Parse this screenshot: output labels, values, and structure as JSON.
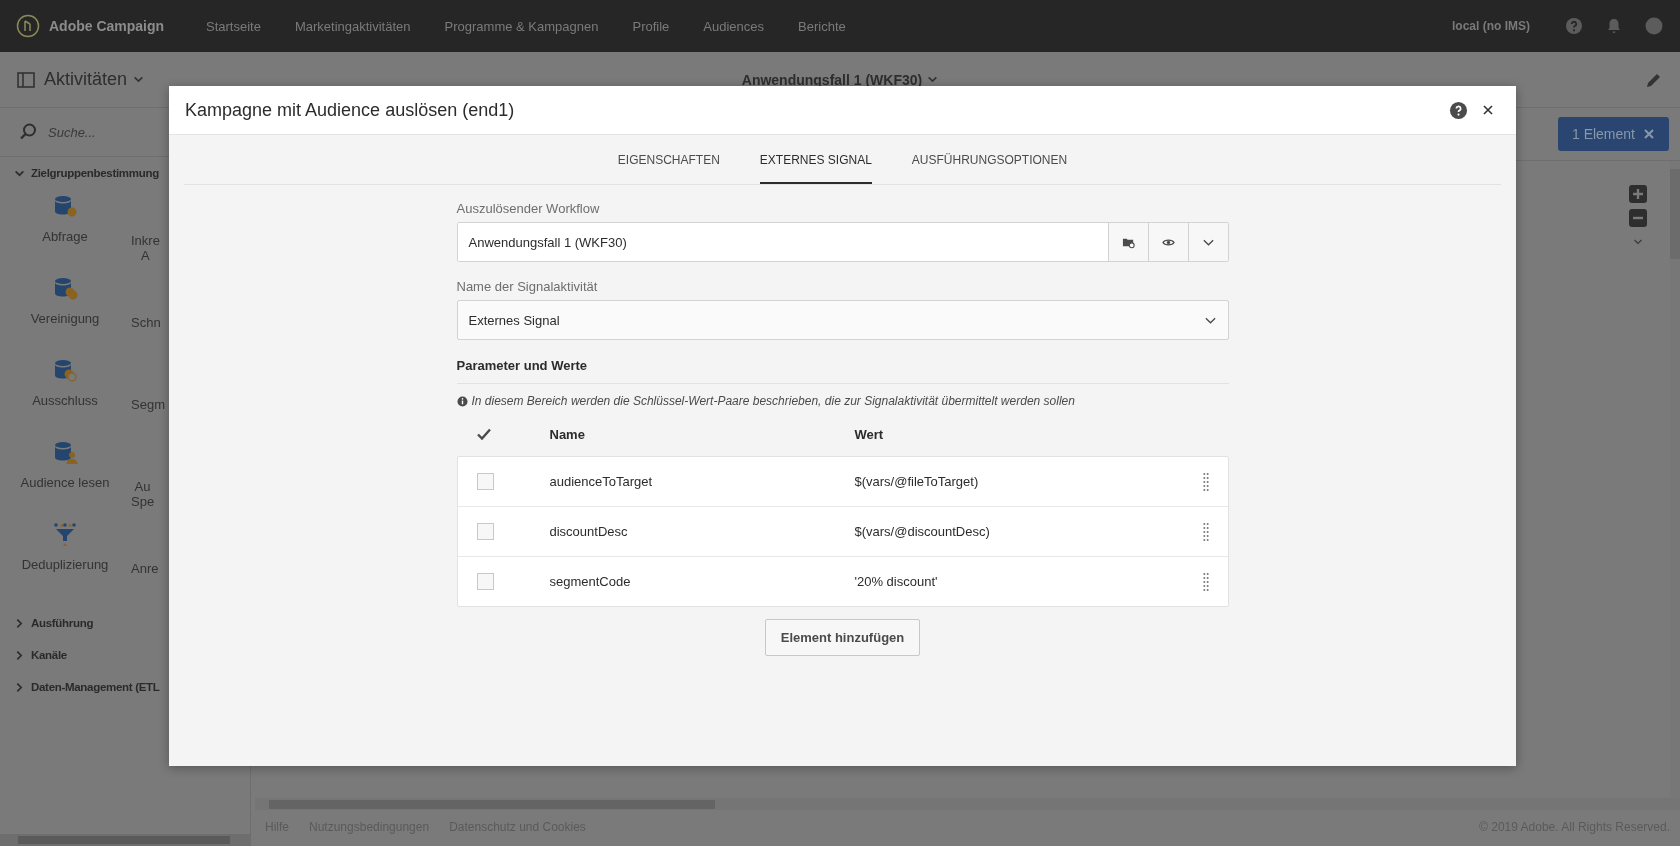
{
  "top_bar": {
    "logo": "Adobe Campaign",
    "nav": [
      {
        "label": "Startseite",
        "selected": false
      },
      {
        "label": "Marketingaktivitäten",
        "selected": false
      },
      {
        "label": "Programme & Kampagnen",
        "selected": false
      },
      {
        "label": "Profile",
        "selected": false
      },
      {
        "label": "Audiences",
        "selected": false
      },
      {
        "label": "Berichte",
        "selected": false
      }
    ],
    "user": "local (no IMS)"
  },
  "toolbar": {
    "menu": "Aktivitäten",
    "title": "Anwendungsfall 1 (WKF30)"
  },
  "sidebar": {
    "search": {
      "placeholder": "Suche..."
    },
    "sections": [
      {
        "label": "Zielgruppenbestimmung",
        "expanded": true,
        "activities": [
          {
            "kind": "query",
            "label": [
              "Abfrage"
            ]
          },
          {
            "kind": "covered",
            "label": [
              "Inkre",
              "A"
            ]
          },
          {
            "kind": "union",
            "label": [
              "Vereinigung"
            ]
          },
          {
            "kind": "covered",
            "label": [
              "Schn"
            ]
          },
          {
            "kind": "exclusion",
            "label": [
              "Ausschluss"
            ]
          },
          {
            "kind": "covered",
            "label": [
              "Segm"
            ]
          },
          {
            "kind": "audience",
            "label": [
              "Audience lesen"
            ]
          },
          {
            "kind": "covered",
            "label": [
              "Au",
              "Spe"
            ]
          },
          {
            "kind": "dedup",
            "label": [
              "Deduplizierung"
            ]
          },
          {
            "kind": "covered",
            "label": [
              "Anre"
            ]
          }
        ]
      },
      {
        "label": "Ausführung",
        "expanded": false
      },
      {
        "label": "Kanäle",
        "expanded": false
      },
      {
        "label": "Daten-Management (ETL",
        "expanded": false
      }
    ]
  },
  "canvas": {
    "selection": "1 Element"
  },
  "footer": {
    "links": [
      "Hilfe",
      "Nutzungsbedingungen",
      "Datenschutz und Cookies"
    ],
    "copyright": "© 2019 Adobe. All Rights Reserved."
  },
  "dialog": {
    "title": "Kampagne mit Audience auslösen (end1)",
    "tabs": [
      {
        "label": "EIGENSCHAFTEN",
        "selected": false
      },
      {
        "label": "EXTERNES SIGNAL",
        "selected": true
      },
      {
        "label": "AUSFÜHRUNGSOPTIONEN",
        "selected": false
      }
    ],
    "workflow": {
      "label": "Auszulösender Workflow",
      "value": "Anwendungsfall 1 (WKF30)"
    },
    "signal": {
      "label": "Name der Signalaktivität",
      "value": "Externes Signal"
    },
    "params": {
      "heading": "Parameter und Werte",
      "info": "In diesem Bereich werden die Schlüssel-Wert-Paare beschrieben, die zur Signalaktivität übermittelt werden sollen",
      "columns": [
        "Name",
        "Wert"
      ],
      "rows": [
        {
          "name": "audienceToTarget",
          "value": "$(vars/@fileToTarget)",
          "checked": false
        },
        {
          "name": "discountDesc",
          "value": "$(vars/@discountDesc)",
          "checked": false
        },
        {
          "name": "segmentCode",
          "value": "'20% discount'",
          "checked": false
        }
      ],
      "add_button": "Element hinzufügen"
    }
  }
}
